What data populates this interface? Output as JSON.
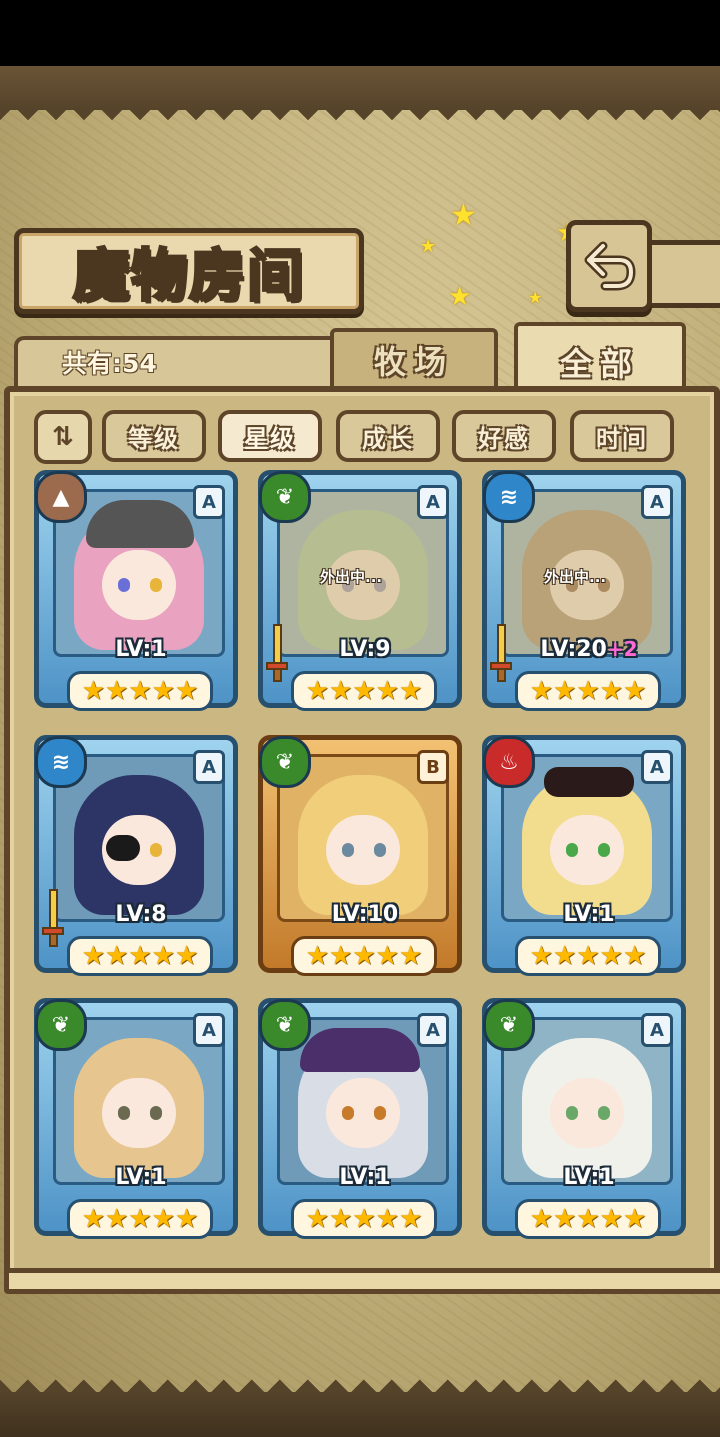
{
  "title": "魔物房间",
  "count_label": "共有:54",
  "tabs": [
    {
      "label": "牧场",
      "active": false
    },
    {
      "label": "全部",
      "active": true
    }
  ],
  "sort_toggle": "⇅",
  "sort_buttons": [
    {
      "label": "等级",
      "active": false
    },
    {
      "label": "星级",
      "active": true
    },
    {
      "label": "成长",
      "active": false
    },
    {
      "label": "好感",
      "active": false
    },
    {
      "label": "时间",
      "active": false
    }
  ],
  "colors": {
    "wood": "#5e4529",
    "card_a": "#4e93c7",
    "card_b": "#c27a2a",
    "element_earth": "#9c6b4e",
    "element_nature": "#3a8a2c",
    "element_water": "#2f86c9",
    "element_fire": "#c92a2a"
  },
  "monsters": [
    {
      "level": "LV:1",
      "rank": "A",
      "element": "earth-icon",
      "stars": "★★★★★",
      "away": "",
      "bonus": ""
    },
    {
      "level": "LV:9",
      "rank": "A",
      "element": "leaf-icon",
      "stars": "★★★★★",
      "away": "外出中...",
      "bonus": ""
    },
    {
      "level": "LV:20",
      "rank": "A",
      "element": "water-icon",
      "stars": "★★★★★",
      "away": "外出中...",
      "bonus": "+2"
    },
    {
      "level": "LV:8",
      "rank": "A",
      "element": "water-icon",
      "stars": "★★★★★",
      "away": "",
      "bonus": ""
    },
    {
      "level": "LV:10",
      "rank": "B",
      "element": "leaf-icon",
      "stars": "★★★★★",
      "away": "",
      "bonus": ""
    },
    {
      "level": "LV:1",
      "rank": "A",
      "element": "fire-icon",
      "stars": "★★★★★",
      "away": "",
      "bonus": ""
    },
    {
      "level": "LV:1",
      "rank": "A",
      "element": "leaf-icon",
      "stars": "★★★★★",
      "away": "",
      "bonus": ""
    },
    {
      "level": "LV:1",
      "rank": "A",
      "element": "leaf-icon",
      "stars": "★★★★★",
      "away": "",
      "bonus": ""
    },
    {
      "level": "LV:1",
      "rank": "A",
      "element": "leaf-icon",
      "stars": "★★★★★",
      "away": "",
      "bonus": ""
    }
  ]
}
